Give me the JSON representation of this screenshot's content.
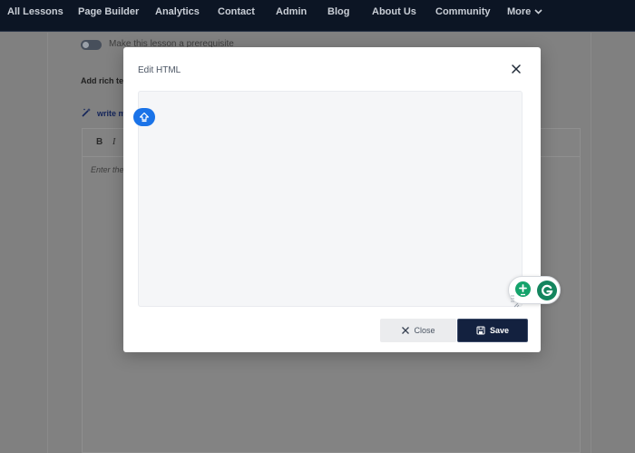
{
  "nav": {
    "items": [
      "All Lessons",
      "Page Builder",
      "Analytics",
      "Contact",
      "Admin",
      "Blog",
      "About Us",
      "Community"
    ],
    "more_label": "More"
  },
  "background": {
    "prerequisite_label": "Make this lesson a prerequisite",
    "rich_text_label": "Add rich te",
    "write_link": "write m",
    "toolbar_bold": "B",
    "toolbar_italic": "I",
    "editor_placeholder": "Enter the"
  },
  "modal": {
    "title": "Edit HTML",
    "html_value": "",
    "close_label": "Close",
    "save_label": "Save"
  },
  "icons": {
    "upload": "upload-arrow-icon",
    "grammarly": "grammarly-icon",
    "add": "add-icon"
  },
  "colors": {
    "nav_bg": "#0c1524",
    "save_bg": "#13213f",
    "upload_accent": "#1a73e8",
    "grammarly_green": "#14855e"
  }
}
